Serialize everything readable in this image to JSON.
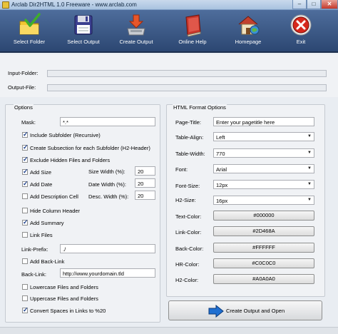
{
  "window": {
    "title": "Arclab Dir2HTML 1.0 Freeware - www.arclab.com",
    "min": "–",
    "max": "□",
    "close": "✕"
  },
  "toolbar": [
    {
      "label": "Select Folder",
      "icon": "folder-check-icon"
    },
    {
      "label": "Select Output",
      "icon": "floppy-disk-icon"
    },
    {
      "label": "Create Output",
      "icon": "download-arrow-icon"
    },
    {
      "label": "Online Help",
      "icon": "help-book-icon"
    },
    {
      "label": "Homepage",
      "icon": "house-icon"
    },
    {
      "label": "Exit",
      "icon": "exit-icon"
    }
  ],
  "io": {
    "input_label": "Input-Folder:",
    "input_value": "",
    "output_label": "Output-File:",
    "output_value": ""
  },
  "options": {
    "title": "Options",
    "mask_label": "Mask:",
    "mask_value": "*.*",
    "include_subfolder": {
      "label": "Include Subfolder (Recursive)",
      "checked": true
    },
    "create_subsection": {
      "label": "Create Subsection for each Subfolder (H2-Header)",
      "checked": true
    },
    "exclude_hidden": {
      "label": "Exclude Hidden Files and Folders",
      "checked": true
    },
    "add_size": {
      "label": "Add Size",
      "checked": true
    },
    "add_date": {
      "label": "Add Date",
      "checked": true
    },
    "add_description": {
      "label": "Add Description Cell",
      "checked": false
    },
    "size_width_label": "Size Width (%):",
    "size_width_value": "20",
    "date_width_label": "Date Width (%):",
    "date_width_value": "20",
    "desc_width_label": "Desc. Width (%):",
    "desc_width_value": "20",
    "hide_column_header": {
      "label": "Hide Column Header",
      "checked": false
    },
    "add_summary": {
      "label": "Add Summary",
      "checked": true
    },
    "link_files": {
      "label": "Link Files",
      "checked": false
    },
    "link_prefix_label": "Link-Prefix:",
    "link_prefix_value": "./",
    "add_back_link": {
      "label": "Add Back-Link",
      "checked": false
    },
    "back_link_label": "Back-Link:",
    "back_link_value": "http://www.yourdomain.tld",
    "lowercase": {
      "label": "Lowercase Files and Folders",
      "checked": false
    },
    "uppercase": {
      "label": "Uppercase Files and Folders",
      "checked": false
    },
    "convert_spaces": {
      "label": "Convert Spaces in Links to %20",
      "checked": true
    }
  },
  "html_format": {
    "title": "HTML Format Options",
    "page_title_label": "Page-Title:",
    "page_title_value": "Enter your pagetitle here",
    "table_align_label": "Table-Align:",
    "table_align_value": "Left",
    "table_width_label": "Table-Width:",
    "table_width_value": "770",
    "font_label": "Font:",
    "font_value": "Arial",
    "font_size_label": "Font-Size:",
    "font_size_value": "12px",
    "h2_size_label": "H2-Size:",
    "h2_size_value": "16px",
    "text_color_label": "Text-Color:",
    "text_color_value": "#000000",
    "link_color_label": "Link-Color:",
    "link_color_value": "#2D468A",
    "back_color_label": "Back-Color:",
    "back_color_value": "#FFFFFF",
    "hr_color_label": "HR-Color:",
    "hr_color_value": "#C0C0C0",
    "h2_color_label": "H2-Color:",
    "h2_color_value": "#A0A0A0"
  },
  "create_button": {
    "label": "Create Output and Open",
    "icon": "right-arrow-icon"
  },
  "colors": {
    "toolbar_bg": "#3a5685",
    "panel_bg": "#f0f2f5",
    "accent_arrow": "#1f6fd1"
  }
}
